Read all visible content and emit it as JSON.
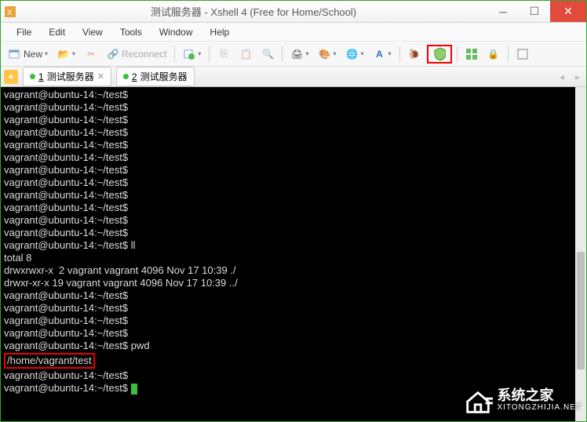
{
  "titlebar": {
    "title": "测试服务器 - Xshell 4 (Free for Home/School)"
  },
  "menubar": {
    "file": "File",
    "edit": "Edit",
    "view": "View",
    "tools": "Tools",
    "window": "Window",
    "help": "Help"
  },
  "toolbar": {
    "new": "New",
    "reconnect": "Reconnect"
  },
  "tabs": {
    "t1_num": "1",
    "t1_label": "测试服务器",
    "t2_num": "2",
    "t2_label": "测试服务器"
  },
  "terminal": {
    "p0": "vagrant@ubuntu-14:~/test$",
    "p1": "vagrant@ubuntu-14:~/test$",
    "p2": "vagrant@ubuntu-14:~/test$",
    "p3": "vagrant@ubuntu-14:~/test$",
    "p4": "vagrant@ubuntu-14:~/test$",
    "p5": "vagrant@ubuntu-14:~/test$",
    "p6": "vagrant@ubuntu-14:~/test$",
    "p7": "vagrant@ubuntu-14:~/test$",
    "p8": "vagrant@ubuntu-14:~/test$",
    "p9": "vagrant@ubuntu-14:~/test$",
    "p10": "vagrant@ubuntu-14:~/test$",
    "p11": "vagrant@ubuntu-14:~/test$",
    "p12": "vagrant@ubuntu-14:~/test$ ll",
    "total": "total 8",
    "ls1": "drwxrwxr-x  2 vagrant vagrant 4096 Nov 17 10:39 ./",
    "ls2": "drwxr-xr-x 19 vagrant vagrant 4096 Nov 17 10:39 ../",
    "p13": "vagrant@ubuntu-14:~/test$",
    "p14": "vagrant@ubuntu-14:~/test$",
    "p15": "vagrant@ubuntu-14:~/test$",
    "p16": "vagrant@ubuntu-14:~/test$",
    "p17": "vagrant@ubuntu-14:~/test$ pwd",
    "pwd_out": "/home/vagrant/test",
    "p18": "vagrant@ubuntu-14:~/test$",
    "p19": "vagrant@ubuntu-14:~/test$ "
  },
  "watermark": {
    "main": "系统之家",
    "sub": "XITONGZHIJIA.NET"
  }
}
